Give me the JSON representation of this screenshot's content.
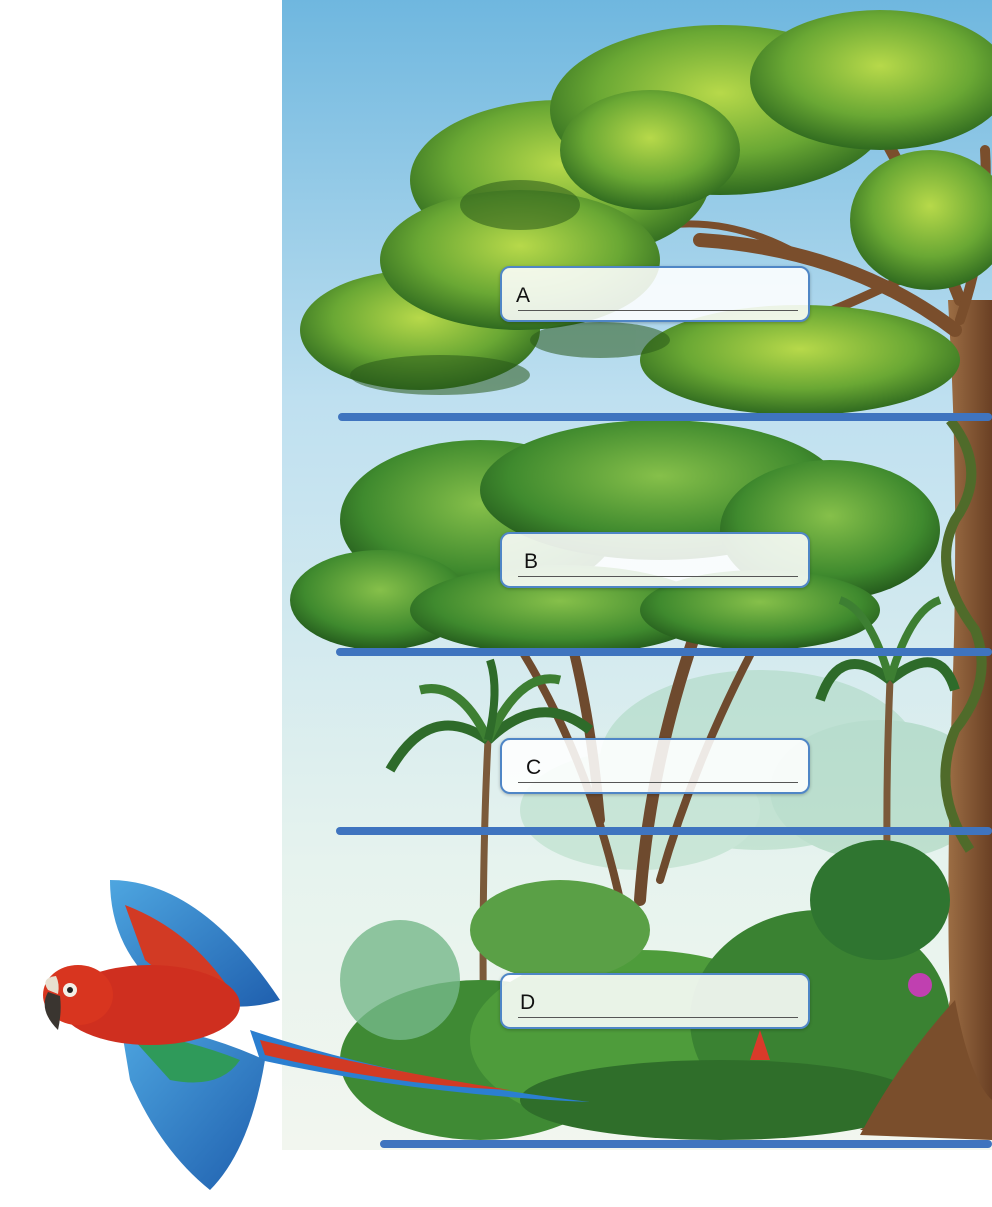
{
  "diagram": {
    "layers": [
      {
        "letter": "A"
      },
      {
        "letter": "B"
      },
      {
        "letter": "C"
      },
      {
        "letter": "D"
      }
    ]
  }
}
